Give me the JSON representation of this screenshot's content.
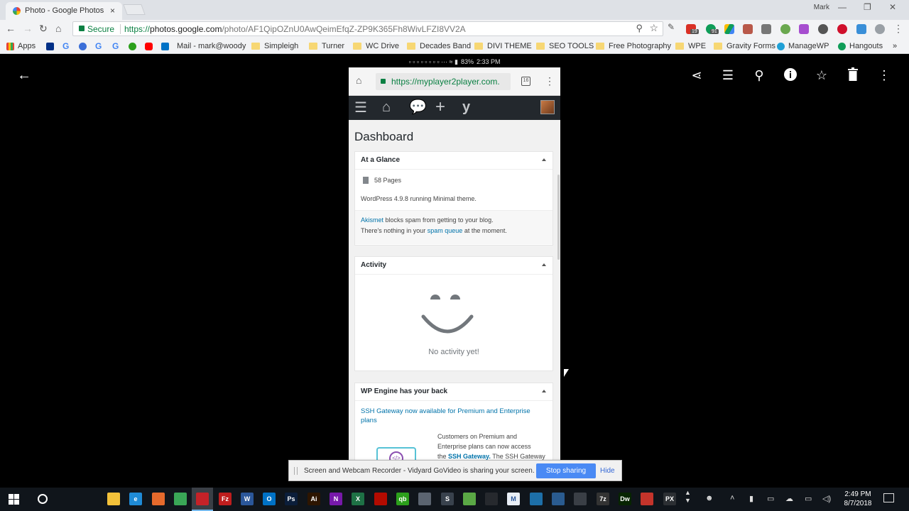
{
  "browser": {
    "tab_title": "Photo - Google Photos",
    "tab_close": "×",
    "window_user": "Mark",
    "secure_label": "Secure",
    "url_scheme": "https://",
    "url_host": "photos.google.com",
    "url_path": "/photo/AF1QipOZnU0AwQeimEfqZ-ZP9K365Fh8WivLFZI8VV2A",
    "ext_badges": [
      "19",
      "91"
    ]
  },
  "bookmarks": [
    {
      "label": "Apps",
      "kind": "apps"
    },
    {
      "label": "",
      "kind": "paypal"
    },
    {
      "label": "G",
      "kind": "g"
    },
    {
      "label": "",
      "kind": "globe"
    },
    {
      "label": "G",
      "kind": "g"
    },
    {
      "label": "G",
      "kind": "g"
    },
    {
      "label": "",
      "kind": "qb"
    },
    {
      "label": "",
      "kind": "youtube"
    },
    {
      "label": "",
      "kind": "outlook"
    },
    {
      "label": "Mail - mark@woody",
      "kind": "mail"
    },
    {
      "label": "Simpleigh",
      "kind": "folder"
    },
    {
      "label": "Turner",
      "kind": "folder"
    },
    {
      "label": "WC Drive",
      "kind": "folder"
    },
    {
      "label": "Decades Band",
      "kind": "folder"
    },
    {
      "label": "DIVI THEME",
      "kind": "folder"
    },
    {
      "label": "SEO TOOLS",
      "kind": "folder"
    },
    {
      "label": "Free Photography",
      "kind": "folder"
    },
    {
      "label": "WPE",
      "kind": "folder"
    },
    {
      "label": "Gravity Forms",
      "kind": "folder"
    },
    {
      "label": "ManageWP",
      "kind": "managewp"
    },
    {
      "label": "Hangouts",
      "kind": "hangouts"
    }
  ],
  "bookmarks_overflow": "»",
  "phone": {
    "status_time": "2:33 PM",
    "status_battery": "83%",
    "url": "https://myplayer2player.com.",
    "tab_count": "16",
    "dashboard_title": "Dashboard",
    "at_a_glance": {
      "title": "At a Glance",
      "pages": "58 Pages",
      "version_text": "WordPress 4.9.8 running Minimal theme.",
      "akismet_link": "Akismet",
      "akismet_text": " blocks spam from getting to your blog.",
      "spam_prefix": "There's nothing in your ",
      "spam_link": "spam queue",
      "spam_suffix": " at the moment."
    },
    "activity": {
      "title": "Activity",
      "empty": "No activity yet!"
    },
    "wp_engine": {
      "title": "WP Engine has your back",
      "link_line1": "SSH Gateway now available for Premium and Enterprise",
      "link_line2": "plans",
      "body_line1": "Customers on Premium and",
      "body_line2": "Enterprise plans can now access",
      "body_line3_prefix": "the ",
      "body_line3_link": "SSH Gateway.",
      "body_line3_suffix": " The SSH Gateway"
    }
  },
  "sharing": {
    "message": "Screen and Webcam Recorder - Vidyard GoVideo is sharing your screen.",
    "stop_label": "Stop sharing",
    "hide_label": "Hide"
  },
  "taskbar": {
    "time": "2:49 PM",
    "date": "8/7/2018",
    "apps": [
      {
        "name": "file-explorer",
        "label": "",
        "color": "#f3c13a"
      },
      {
        "name": "internet-explorer",
        "label": "e",
        "color": "#1f8bd6"
      },
      {
        "name": "firefox",
        "label": "",
        "color": "#e66a2c"
      },
      {
        "name": "chrome",
        "label": "",
        "color": "#3aa757"
      },
      {
        "name": "app-red",
        "label": "",
        "color": "#c52228"
      },
      {
        "name": "filezilla",
        "label": "Fz",
        "color": "#bf1e1e"
      },
      {
        "name": "word",
        "label": "W",
        "color": "#2b579a"
      },
      {
        "name": "outlook",
        "label": "O",
        "color": "#0072c6"
      },
      {
        "name": "photoshop",
        "label": "Ps",
        "color": "#0b1e3a"
      },
      {
        "name": "illustrator",
        "label": "Ai",
        "color": "#2d1500"
      },
      {
        "name": "onenote",
        "label": "N",
        "color": "#7719aa"
      },
      {
        "name": "excel",
        "label": "X",
        "color": "#1e7145"
      },
      {
        "name": "acrobat",
        "label": "",
        "color": "#b30b00"
      },
      {
        "name": "quickbooks",
        "label": "qb",
        "color": "#2ca01c"
      },
      {
        "name": "app-gray",
        "label": "",
        "color": "#5b6470"
      },
      {
        "name": "app-s",
        "label": "S",
        "color": "#39424d"
      },
      {
        "name": "app-green",
        "label": "",
        "color": "#5aa845"
      },
      {
        "name": "app-dark",
        "label": "",
        "color": "#26292e"
      },
      {
        "name": "app-m",
        "label": "M",
        "color": "#e8eef6"
      },
      {
        "name": "app-cam",
        "label": "",
        "color": "#1d6fa8"
      },
      {
        "name": "app-feather",
        "label": "",
        "color": "#2a5b8f"
      },
      {
        "name": "app-bot",
        "label": "",
        "color": "#3a3f46"
      },
      {
        "name": "7zip",
        "label": "7z",
        "color": "#333333"
      },
      {
        "name": "dreamweaver",
        "label": "Dw",
        "color": "#072401"
      },
      {
        "name": "app-ccleaner",
        "label": "",
        "color": "#c4342b"
      },
      {
        "name": "app-px",
        "label": "PX",
        "color": "#2c2f33"
      }
    ]
  }
}
